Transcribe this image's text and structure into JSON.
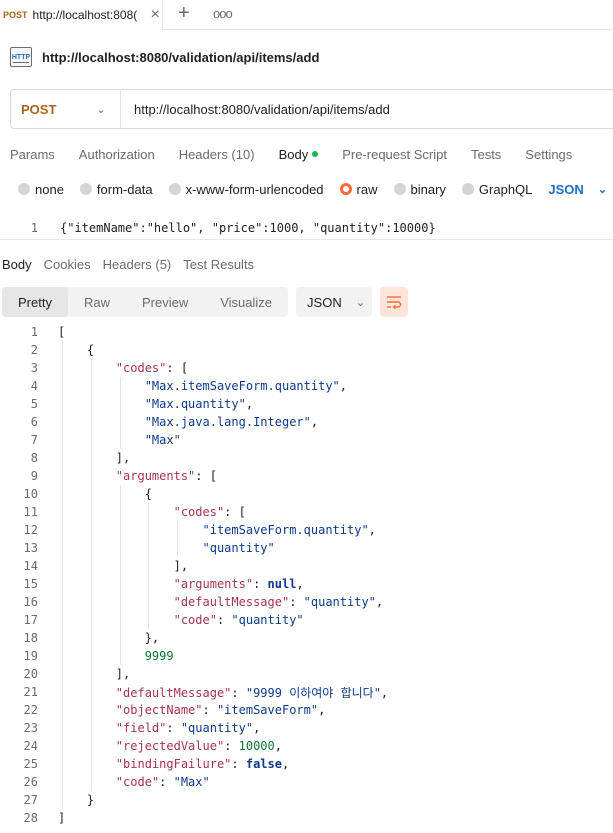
{
  "tab": {
    "method": "POST",
    "title": "http://localhost:808(",
    "close": "×",
    "add": "+",
    "more": "ooo"
  },
  "request": {
    "icon_text": "HTTP",
    "name": "http://localhost:8080/validation/api/items/add",
    "method": "POST",
    "url": "http://localhost:8080/validation/api/items/add",
    "tabs": [
      "Params",
      "Authorization",
      "Headers (10)",
      "Body",
      "Pre-request Script",
      "Tests",
      "Settings"
    ],
    "active_tab": "Body",
    "body_types": [
      "none",
      "form-data",
      "x-www-form-urlencoded",
      "raw",
      "binary",
      "GraphQL"
    ],
    "selected_body_type": "raw",
    "format": "JSON",
    "body_line_number": "1",
    "body": "{\"itemName\":\"hello\", \"price\":1000, \"quantity\":10000}"
  },
  "response": {
    "tabs": [
      "Body",
      "Cookies",
      "Headers (5)",
      "Test Results"
    ],
    "active_tab": "Body",
    "view_modes": [
      "Pretty",
      "Raw",
      "Preview",
      "Visualize"
    ],
    "active_view": "Pretty",
    "format": "JSON",
    "lines": [
      {
        "n": "1",
        "indent": 0,
        "tokens": [
          [
            "p",
            "["
          ]
        ]
      },
      {
        "n": "2",
        "indent": 1,
        "tokens": [
          [
            "p",
            "{"
          ]
        ]
      },
      {
        "n": "3",
        "indent": 2,
        "tokens": [
          [
            "k",
            "\"codes\""
          ],
          [
            "p",
            ": ["
          ]
        ]
      },
      {
        "n": "4",
        "indent": 3,
        "tokens": [
          [
            "s",
            "\"Max.itemSaveForm.quantity\""
          ],
          [
            "p",
            ","
          ]
        ]
      },
      {
        "n": "5",
        "indent": 3,
        "tokens": [
          [
            "s",
            "\"Max.quantity\""
          ],
          [
            "p",
            ","
          ]
        ]
      },
      {
        "n": "6",
        "indent": 3,
        "tokens": [
          [
            "s",
            "\"Max.java.lang.Integer\""
          ],
          [
            "p",
            ","
          ]
        ]
      },
      {
        "n": "7",
        "indent": 3,
        "tokens": [
          [
            "s",
            "\"Max\""
          ]
        ]
      },
      {
        "n": "8",
        "indent": 2,
        "tokens": [
          [
            "p",
            "],"
          ]
        ]
      },
      {
        "n": "9",
        "indent": 2,
        "tokens": [
          [
            "k",
            "\"arguments\""
          ],
          [
            "p",
            ": ["
          ]
        ]
      },
      {
        "n": "10",
        "indent": 3,
        "tokens": [
          [
            "p",
            "{"
          ]
        ]
      },
      {
        "n": "11",
        "indent": 4,
        "tokens": [
          [
            "k",
            "\"codes\""
          ],
          [
            "p",
            ": ["
          ]
        ]
      },
      {
        "n": "12",
        "indent": 5,
        "tokens": [
          [
            "s",
            "\"itemSaveForm.quantity\""
          ],
          [
            "p",
            ","
          ]
        ]
      },
      {
        "n": "13",
        "indent": 5,
        "tokens": [
          [
            "s",
            "\"quantity\""
          ]
        ]
      },
      {
        "n": "14",
        "indent": 4,
        "tokens": [
          [
            "p",
            "],"
          ]
        ]
      },
      {
        "n": "15",
        "indent": 4,
        "tokens": [
          [
            "k",
            "\"arguments\""
          ],
          [
            "p",
            ": "
          ],
          [
            "b",
            "null"
          ],
          [
            "p",
            ","
          ]
        ]
      },
      {
        "n": "16",
        "indent": 4,
        "tokens": [
          [
            "k",
            "\"defaultMessage\""
          ],
          [
            "p",
            ": "
          ],
          [
            "s",
            "\"quantity\""
          ],
          [
            "p",
            ","
          ]
        ]
      },
      {
        "n": "17",
        "indent": 4,
        "tokens": [
          [
            "k",
            "\"code\""
          ],
          [
            "p",
            ": "
          ],
          [
            "s",
            "\"quantity\""
          ]
        ]
      },
      {
        "n": "18",
        "indent": 3,
        "tokens": [
          [
            "p",
            "},"
          ]
        ]
      },
      {
        "n": "19",
        "indent": 3,
        "tokens": [
          [
            "n",
            "9999"
          ]
        ]
      },
      {
        "n": "20",
        "indent": 2,
        "tokens": [
          [
            "p",
            "],"
          ]
        ]
      },
      {
        "n": "21",
        "indent": 2,
        "tokens": [
          [
            "k",
            "\"defaultMessage\""
          ],
          [
            "p",
            ": "
          ],
          [
            "s",
            "\"9999 이하여야 합니다\""
          ],
          [
            "p",
            ","
          ]
        ]
      },
      {
        "n": "22",
        "indent": 2,
        "tokens": [
          [
            "k",
            "\"objectName\""
          ],
          [
            "p",
            ": "
          ],
          [
            "s",
            "\"itemSaveForm\""
          ],
          [
            "p",
            ","
          ]
        ]
      },
      {
        "n": "23",
        "indent": 2,
        "tokens": [
          [
            "k",
            "\"field\""
          ],
          [
            "p",
            ": "
          ],
          [
            "s",
            "\"quantity\""
          ],
          [
            "p",
            ","
          ]
        ]
      },
      {
        "n": "24",
        "indent": 2,
        "tokens": [
          [
            "k",
            "\"rejectedValue\""
          ],
          [
            "p",
            ": "
          ],
          [
            "n",
            "10000"
          ],
          [
            "p",
            ","
          ]
        ]
      },
      {
        "n": "25",
        "indent": 2,
        "tokens": [
          [
            "k",
            "\"bindingFailure\""
          ],
          [
            "p",
            ": "
          ],
          [
            "b",
            "false"
          ],
          [
            "p",
            ","
          ]
        ]
      },
      {
        "n": "26",
        "indent": 2,
        "tokens": [
          [
            "k",
            "\"code\""
          ],
          [
            "p",
            ": "
          ],
          [
            "s",
            "\"Max\""
          ]
        ]
      },
      {
        "n": "27",
        "indent": 1,
        "tokens": [
          [
            "p",
            "}"
          ]
        ]
      },
      {
        "n": "28",
        "indent": 0,
        "tokens": [
          [
            "p",
            "]"
          ]
        ]
      }
    ]
  }
}
